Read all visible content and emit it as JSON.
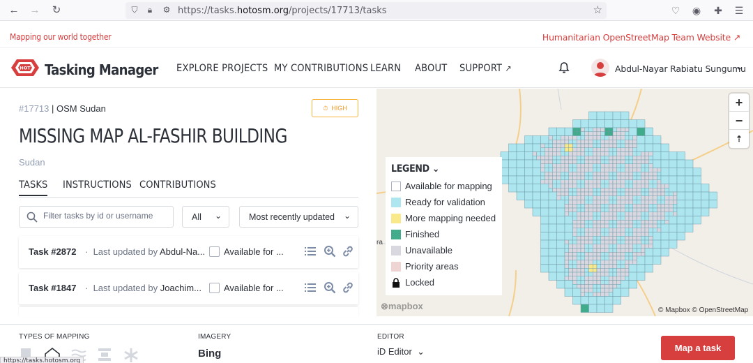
{
  "browser": {
    "url_prefix": "https://tasks.",
    "url_host": "hotosm.org",
    "url_path": "/projects/17713/tasks",
    "status_url": "https://tasks.hotosm.org"
  },
  "topstrip": {
    "tagline": "Mapping our world together",
    "hot_link": "Humanitarian OpenStreetMap Team Website"
  },
  "header": {
    "logo_text": "HOT",
    "brand": "Tasking Manager",
    "nav": [
      "EXPLORE PROJECTS",
      "MY CONTRIBUTIONS",
      "LEARN",
      "ABOUT",
      "SUPPORT"
    ],
    "user_name": "Abdul-Nayar Rabiatu Sungumu"
  },
  "project": {
    "id": "#17713",
    "org": " | OSM Sudan",
    "priority": "HIGH",
    "title": "MISSING MAP AL-FASHIR BUILDING",
    "country": "Sudan",
    "tabs": [
      "TASKS",
      "INSTRUCTIONS",
      "CONTRIBUTIONS"
    ]
  },
  "filters": {
    "search_placeholder": "Filter tasks by id or username",
    "status_select": "All",
    "sort_select": "Most recently updated"
  },
  "tasks": [
    {
      "id": "Task #2872",
      "updated_prefix": "Last updated by ",
      "user": "Abdul-Na...",
      "status": "Available for ..."
    },
    {
      "id": "Task #1847",
      "updated_prefix": "Last updated by ",
      "user": "Joachim...",
      "status": "Available for ..."
    }
  ],
  "map": {
    "legend_title": "LEGEND",
    "legend_items": [
      {
        "label": "Available for mapping",
        "color": "#ffffff"
      },
      {
        "label": "Ready for validation",
        "color": "#ade6ef"
      },
      {
        "label": "More mapping needed",
        "color": "#f9e98a"
      },
      {
        "label": "Finished",
        "color": "#40ac8c"
      },
      {
        "label": "Unavailable",
        "color": "#d9d7e0"
      },
      {
        "label": "Priority areas",
        "color": "#efd4d4"
      },
      {
        "label": "Locked",
        "color": "#000000"
      }
    ],
    "mapbox_logo": "mapbox",
    "attribution": "© Mapbox © OpenStreetMap",
    "zoom_in": "+",
    "zoom_out": "−"
  },
  "bottom": {
    "types_label": "TYPES OF MAPPING",
    "imagery_label": "IMAGERY",
    "imagery_value": "Bing",
    "editor_label": "EDITOR",
    "editor_value": "iD Editor",
    "map_button": "Map a task"
  },
  "colors": {
    "accent": "#d73f3f",
    "priority": "#f09a28"
  }
}
